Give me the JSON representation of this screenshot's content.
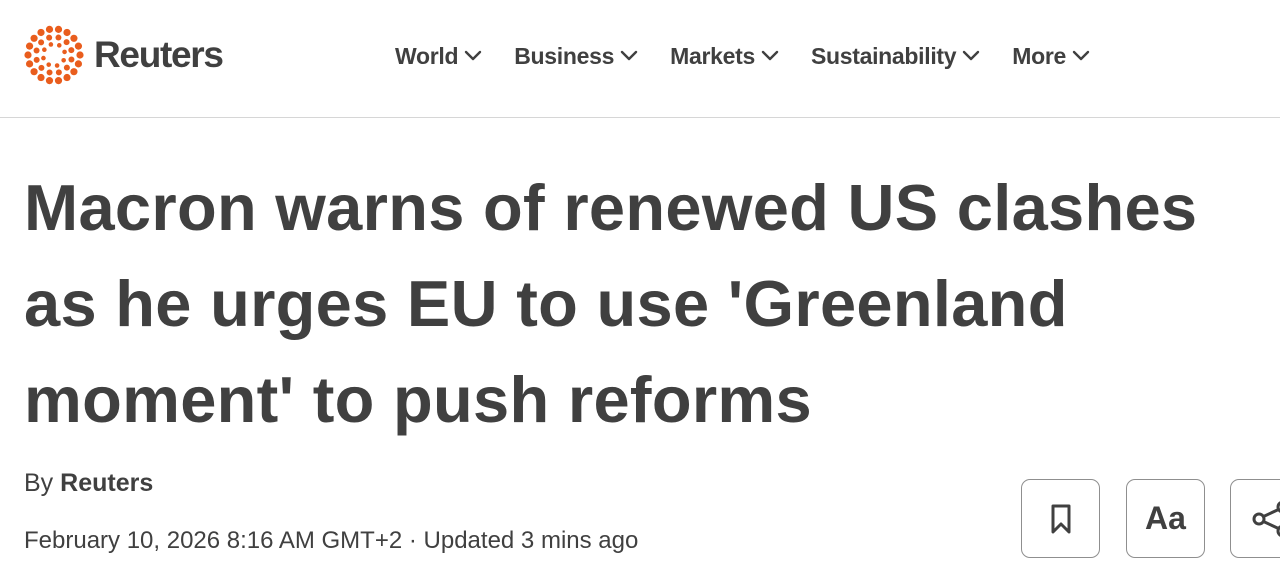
{
  "header": {
    "logo_text": "Reuters",
    "logo_color": "#e95d1d",
    "nav": [
      {
        "label": "World",
        "icon": "chevron-down-icon"
      },
      {
        "label": "Business",
        "icon": "chevron-down-icon"
      },
      {
        "label": "Markets",
        "icon": "chevron-down-icon"
      },
      {
        "label": "Sustainability",
        "icon": "chevron-down-icon"
      },
      {
        "label": "More",
        "icon": "chevron-down-icon"
      }
    ]
  },
  "article": {
    "headline": "Macron warns of renewed US clashes as he urges EU to use 'Greenland moment' to push reforms",
    "byline_prefix": "By",
    "author": "Reuters",
    "dateline": "February 10, 2026 8:16 AM GMT+2 · Updated 3 mins ago"
  },
  "toolbar": {
    "bookmark_icon": "bookmark-icon",
    "text_size_label": "Aa",
    "share_icon": "share-icon"
  }
}
